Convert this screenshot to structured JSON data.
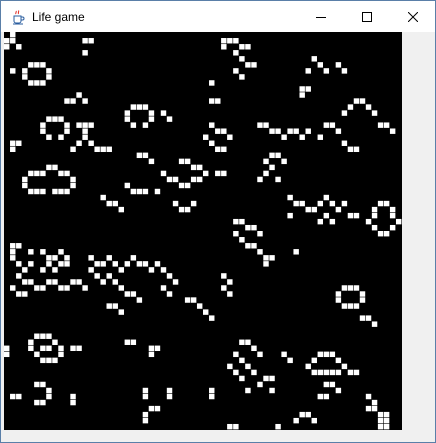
{
  "window": {
    "title": "Life game",
    "icons": {
      "app": "java-cup-icon",
      "minimize": "minimize-icon",
      "maximize": "maximize-icon",
      "close": "close-icon"
    }
  },
  "board": {
    "background": "#000000",
    "cell_color": "#ffffff",
    "grid_size": 66,
    "live_cells": [
      [
        0,
        1
      ],
      [
        1,
        1
      ],
      [
        1,
        0
      ],
      [
        0,
        2
      ],
      [
        2,
        2
      ],
      [
        13,
        1
      ],
      [
        14,
        1
      ],
      [
        13,
        3
      ],
      [
        36,
        1
      ],
      [
        37,
        1
      ],
      [
        38,
        1
      ],
      [
        39,
        2
      ],
      [
        40,
        2
      ],
      [
        36,
        2
      ],
      [
        38,
        3
      ],
      [
        39,
        4
      ],
      [
        40,
        5
      ],
      [
        41,
        5
      ],
      [
        38,
        6
      ],
      [
        39,
        7
      ],
      [
        51,
        4
      ],
      [
        52,
        5
      ],
      [
        53,
        6
      ],
      [
        55,
        5
      ],
      [
        56,
        6
      ],
      [
        50,
        6
      ],
      [
        4,
        5
      ],
      [
        5,
        5
      ],
      [
        6,
        5
      ],
      [
        3,
        6
      ],
      [
        7,
        6
      ],
      [
        3,
        7
      ],
      [
        7,
        7
      ],
      [
        4,
        8
      ],
      [
        5,
        8
      ],
      [
        6,
        8
      ],
      [
        1,
        6
      ],
      [
        34,
        8
      ],
      [
        49,
        9
      ],
      [
        50,
        9
      ],
      [
        49,
        10
      ],
      [
        10,
        11
      ],
      [
        11,
        11
      ],
      [
        12,
        10
      ],
      [
        13,
        11
      ],
      [
        34,
        11
      ],
      [
        35,
        11
      ],
      [
        58,
        11
      ],
      [
        59,
        11
      ],
      [
        57,
        12
      ],
      [
        60,
        12
      ],
      [
        56,
        13
      ],
      [
        61,
        13
      ],
      [
        21,
        12
      ],
      [
        22,
        12
      ],
      [
        23,
        12
      ],
      [
        20,
        13
      ],
      [
        24,
        13
      ],
      [
        20,
        14
      ],
      [
        24,
        14
      ],
      [
        21,
        15
      ],
      [
        23,
        15
      ],
      [
        26,
        13
      ],
      [
        27,
        14
      ],
      [
        7,
        14
      ],
      [
        8,
        14
      ],
      [
        9,
        14
      ],
      [
        6,
        15
      ],
      [
        10,
        15
      ],
      [
        6,
        16
      ],
      [
        10,
        16
      ],
      [
        7,
        17
      ],
      [
        9,
        17
      ],
      [
        12,
        15
      ],
      [
        13,
        15
      ],
      [
        14,
        15
      ],
      [
        13,
        16
      ],
      [
        13,
        17
      ],
      [
        12,
        18
      ],
      [
        14,
        18
      ],
      [
        11,
        19
      ],
      [
        15,
        19
      ],
      [
        42,
        15
      ],
      [
        43,
        15
      ],
      [
        44,
        16
      ],
      [
        45,
        16
      ],
      [
        46,
        17
      ],
      [
        47,
        16
      ],
      [
        48,
        16
      ],
      [
        49,
        17
      ],
      [
        50,
        16
      ],
      [
        53,
        15
      ],
      [
        54,
        15
      ],
      [
        55,
        16
      ],
      [
        52,
        17
      ],
      [
        56,
        18
      ],
      [
        57,
        19
      ],
      [
        58,
        19
      ],
      [
        62,
        15
      ],
      [
        63,
        15
      ],
      [
        64,
        16
      ],
      [
        34,
        15
      ],
      [
        35,
        16
      ],
      [
        36,
        16
      ],
      [
        33,
        17
      ],
      [
        37,
        17
      ],
      [
        34,
        18
      ],
      [
        35,
        19
      ],
      [
        36,
        19
      ],
      [
        1,
        18
      ],
      [
        2,
        18
      ],
      [
        1,
        19
      ],
      [
        16,
        19
      ],
      [
        17,
        19
      ],
      [
        22,
        20
      ],
      [
        23,
        20
      ],
      [
        24,
        21
      ],
      [
        44,
        20
      ],
      [
        45,
        20
      ],
      [
        43,
        21
      ],
      [
        46,
        21
      ],
      [
        44,
        22
      ],
      [
        43,
        23
      ],
      [
        42,
        24
      ],
      [
        45,
        24
      ],
      [
        4,
        23
      ],
      [
        5,
        23
      ],
      [
        6,
        23
      ],
      [
        7,
        22
      ],
      [
        8,
        22
      ],
      [
        9,
        23
      ],
      [
        10,
        23
      ],
      [
        3,
        24
      ],
      [
        11,
        24
      ],
      [
        3,
        25
      ],
      [
        11,
        25
      ],
      [
        4,
        26
      ],
      [
        5,
        26
      ],
      [
        6,
        26
      ],
      [
        8,
        26
      ],
      [
        9,
        26
      ],
      [
        10,
        26
      ],
      [
        29,
        21
      ],
      [
        30,
        21
      ],
      [
        31,
        22
      ],
      [
        32,
        22
      ],
      [
        26,
        23
      ],
      [
        27,
        24
      ],
      [
        28,
        24
      ],
      [
        29,
        25
      ],
      [
        30,
        25
      ],
      [
        31,
        24
      ],
      [
        32,
        24
      ],
      [
        33,
        23
      ],
      [
        35,
        23
      ],
      [
        36,
        23
      ],
      [
        20,
        25
      ],
      [
        21,
        26
      ],
      [
        22,
        26
      ],
      [
        23,
        26
      ],
      [
        25,
        26
      ],
      [
        16,
        27
      ],
      [
        17,
        28
      ],
      [
        18,
        28
      ],
      [
        19,
        29
      ],
      [
        28,
        28
      ],
      [
        29,
        29
      ],
      [
        30,
        29
      ],
      [
        31,
        28
      ],
      [
        47,
        27
      ],
      [
        48,
        28
      ],
      [
        49,
        28
      ],
      [
        50,
        29
      ],
      [
        51,
        29
      ],
      [
        52,
        28
      ],
      [
        53,
        27
      ],
      [
        54,
        28
      ],
      [
        55,
        29
      ],
      [
        56,
        28
      ],
      [
        47,
        30
      ],
      [
        52,
        31
      ],
      [
        53,
        30
      ],
      [
        54,
        31
      ],
      [
        57,
        30
      ],
      [
        58,
        30
      ],
      [
        62,
        28
      ],
      [
        63,
        28
      ],
      [
        61,
        29
      ],
      [
        64,
        29
      ],
      [
        61,
        30
      ],
      [
        64,
        30
      ],
      [
        60,
        31
      ],
      [
        65,
        31
      ],
      [
        61,
        32
      ],
      [
        64,
        32
      ],
      [
        62,
        33
      ],
      [
        63,
        33
      ],
      [
        38,
        31
      ],
      [
        39,
        31
      ],
      [
        40,
        32
      ],
      [
        41,
        32
      ],
      [
        38,
        33
      ],
      [
        42,
        33
      ],
      [
        39,
        34
      ],
      [
        40,
        35
      ],
      [
        41,
        35
      ],
      [
        42,
        36
      ],
      [
        43,
        37
      ],
      [
        44,
        37
      ],
      [
        43,
        38
      ],
      [
        48,
        36
      ],
      [
        1,
        35
      ],
      [
        2,
        35
      ],
      [
        1,
        36
      ],
      [
        1,
        37
      ],
      [
        2,
        38
      ],
      [
        3,
        39
      ],
      [
        4,
        38
      ],
      [
        4,
        36
      ],
      [
        6,
        36
      ],
      [
        7,
        37
      ],
      [
        8,
        37
      ],
      [
        9,
        36
      ],
      [
        10,
        37
      ],
      [
        7,
        38
      ],
      [
        6,
        39
      ],
      [
        8,
        39
      ],
      [
        9,
        38
      ],
      [
        10,
        38
      ],
      [
        14,
        37
      ],
      [
        15,
        38
      ],
      [
        16,
        38
      ],
      [
        17,
        37
      ],
      [
        18,
        38
      ],
      [
        19,
        39
      ],
      [
        20,
        38
      ],
      [
        21,
        37
      ],
      [
        22,
        38
      ],
      [
        14,
        39
      ],
      [
        15,
        40
      ],
      [
        16,
        41
      ],
      [
        17,
        40
      ],
      [
        18,
        41
      ],
      [
        19,
        42
      ],
      [
        23,
        38
      ],
      [
        24,
        39
      ],
      [
        25,
        38
      ],
      [
        26,
        39
      ],
      [
        27,
        40
      ],
      [
        28,
        41
      ],
      [
        26,
        42
      ],
      [
        27,
        43
      ],
      [
        30,
        44
      ],
      [
        31,
        44
      ],
      [
        32,
        45
      ],
      [
        33,
        46
      ],
      [
        34,
        47
      ],
      [
        2,
        40
      ],
      [
        3,
        41
      ],
      [
        4,
        41
      ],
      [
        5,
        42
      ],
      [
        6,
        42
      ],
      [
        7,
        41
      ],
      [
        8,
        41
      ],
      [
        9,
        42
      ],
      [
        10,
        42
      ],
      [
        11,
        41
      ],
      [
        12,
        41
      ],
      [
        13,
        42
      ],
      [
        1,
        42
      ],
      [
        2,
        43
      ],
      [
        3,
        43
      ],
      [
        20,
        43
      ],
      [
        21,
        43
      ],
      [
        22,
        44
      ],
      [
        17,
        45
      ],
      [
        18,
        45
      ],
      [
        19,
        46
      ],
      [
        36,
        40
      ],
      [
        37,
        41
      ],
      [
        36,
        42
      ],
      [
        37,
        43
      ],
      [
        56,
        42
      ],
      [
        57,
        42
      ],
      [
        58,
        42
      ],
      [
        55,
        43
      ],
      [
        59,
        43
      ],
      [
        55,
        44
      ],
      [
        59,
        44
      ],
      [
        56,
        45
      ],
      [
        57,
        45
      ],
      [
        58,
        45
      ],
      [
        59,
        47
      ],
      [
        60,
        47
      ],
      [
        61,
        48
      ],
      [
        5,
        50
      ],
      [
        6,
        50
      ],
      [
        7,
        50
      ],
      [
        8,
        51
      ],
      [
        9,
        52
      ],
      [
        9,
        53
      ],
      [
        8,
        54
      ],
      [
        7,
        54
      ],
      [
        6,
        54
      ],
      [
        5,
        53
      ],
      [
        4,
        52
      ],
      [
        4,
        51
      ],
      [
        6,
        52
      ],
      [
        7,
        52
      ],
      [
        11,
        52
      ],
      [
        12,
        52
      ],
      [
        20,
        51
      ],
      [
        21,
        51
      ],
      [
        24,
        52
      ],
      [
        25,
        52
      ],
      [
        24,
        53
      ],
      [
        0,
        52
      ],
      [
        0,
        53
      ],
      [
        39,
        51
      ],
      [
        40,
        51
      ],
      [
        41,
        52
      ],
      [
        38,
        53
      ],
      [
        42,
        53
      ],
      [
        39,
        54
      ],
      [
        40,
        55
      ],
      [
        37,
        55
      ],
      [
        38,
        56
      ],
      [
        39,
        57
      ],
      [
        41,
        56
      ],
      [
        43,
        57
      ],
      [
        44,
        57
      ],
      [
        42,
        58
      ],
      [
        40,
        59
      ],
      [
        44,
        59
      ],
      [
        46,
        53
      ],
      [
        47,
        54
      ],
      [
        52,
        53
      ],
      [
        53,
        53
      ],
      [
        54,
        53
      ],
      [
        51,
        54
      ],
      [
        55,
        54
      ],
      [
        50,
        55
      ],
      [
        51,
        56
      ],
      [
        52,
        56
      ],
      [
        53,
        56
      ],
      [
        54,
        56
      ],
      [
        55,
        56
      ],
      [
        56,
        55
      ],
      [
        57,
        56
      ],
      [
        58,
        56
      ],
      [
        53,
        58
      ],
      [
        54,
        58
      ],
      [
        55,
        59
      ],
      [
        52,
        60
      ],
      [
        53,
        60
      ],
      [
        5,
        58
      ],
      [
        6,
        58
      ],
      [
        7,
        59
      ],
      [
        7,
        60
      ],
      [
        6,
        61
      ],
      [
        5,
        61
      ],
      [
        1,
        60
      ],
      [
        2,
        60
      ],
      [
        11,
        60
      ],
      [
        11,
        61
      ],
      [
        23,
        59
      ],
      [
        23,
        60
      ],
      [
        27,
        59
      ],
      [
        27,
        60
      ],
      [
        34,
        59
      ],
      [
        34,
        60
      ],
      [
        24,
        62
      ],
      [
        25,
        62
      ],
      [
        23,
        63
      ],
      [
        23,
        64
      ],
      [
        28,
        66
      ],
      [
        35,
        66
      ],
      [
        36,
        66
      ],
      [
        37,
        65
      ],
      [
        38,
        65
      ],
      [
        39,
        66
      ],
      [
        45,
        65
      ],
      [
        46,
        66
      ],
      [
        47,
        66
      ],
      [
        49,
        63
      ],
      [
        50,
        63
      ],
      [
        48,
        64
      ],
      [
        51,
        64
      ],
      [
        60,
        62
      ],
      [
        61,
        62
      ],
      [
        62,
        63
      ],
      [
        63,
        63
      ],
      [
        62,
        64
      ],
      [
        63,
        64
      ],
      [
        62,
        65
      ],
      [
        63,
        65
      ],
      [
        60,
        60
      ],
      [
        61,
        61
      ]
    ]
  }
}
